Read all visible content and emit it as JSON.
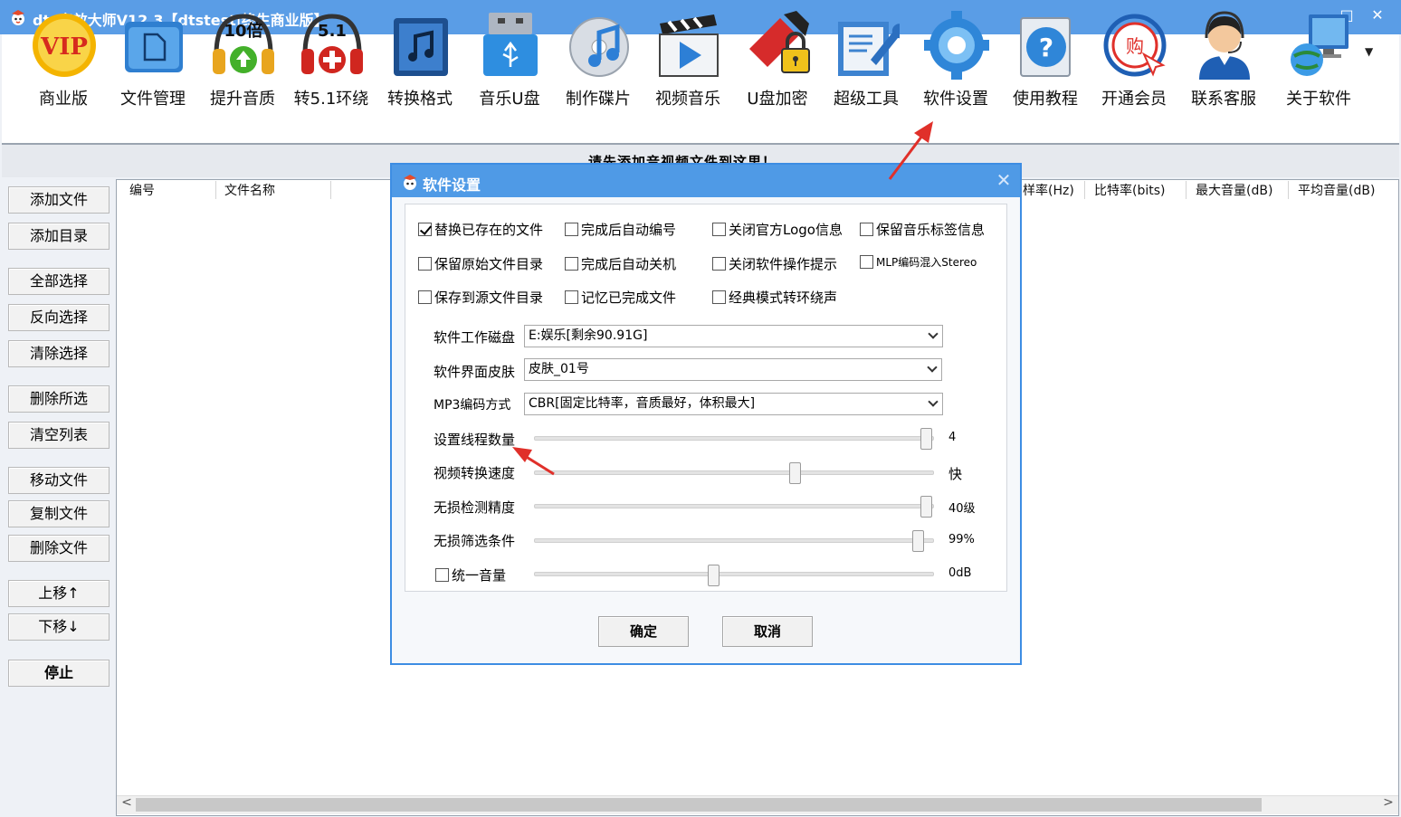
{
  "window": {
    "title": "dts音效大师V12.3【dtstest|终生商业版】",
    "minimize": "−",
    "maximize": "□",
    "close": "✕"
  },
  "toolbar": {
    "items": [
      {
        "label": "商业版",
        "icon": "vip-icon"
      },
      {
        "label": "文件管理",
        "icon": "file-manager-icon"
      },
      {
        "label": "提升音质",
        "icon": "boost-quality-icon",
        "badge": "10倍"
      },
      {
        "label": "转5.1环绕",
        "icon": "surround-icon",
        "badge": "5.1"
      },
      {
        "label": "转换格式",
        "icon": "convert-format-icon"
      },
      {
        "label": "音乐U盘",
        "icon": "usb-music-icon"
      },
      {
        "label": "制作碟片",
        "icon": "disc-icon"
      },
      {
        "label": "视频音乐",
        "icon": "video-music-icon"
      },
      {
        "label": "U盘加密",
        "icon": "usb-lock-icon"
      },
      {
        "label": "超级工具",
        "icon": "super-tools-icon"
      },
      {
        "label": "软件设置",
        "icon": "settings-gear-icon"
      },
      {
        "label": "使用教程",
        "icon": "help-icon"
      },
      {
        "label": "开通会员",
        "icon": "shop-member-icon",
        "badge": "购"
      },
      {
        "label": "联系客服",
        "icon": "customer-service-icon"
      },
      {
        "label": "关于软件",
        "icon": "about-icon"
      }
    ],
    "more": "▼"
  },
  "banner": "请先添加音视频文件到这里！",
  "sidebar": {
    "buttons": [
      "添加文件",
      "添加目录",
      "全部选择",
      "反向选择",
      "清除选择",
      "删除所选",
      "清空列表",
      "移动文件",
      "复制文件",
      "删除文件",
      "上移↑",
      "下移↓",
      "停止"
    ]
  },
  "filelist": {
    "columns": [
      "编号",
      "文件名称",
      "样率(Hz)",
      "比特率(bits)",
      "最大音量(dB)",
      "平均音量(dB)"
    ],
    "scroll_left": "<",
    "scroll_right": ">"
  },
  "dialog": {
    "title": "软件设置",
    "close": "✕",
    "checkboxes": [
      {
        "label": "替换已存在的文件",
        "checked": true
      },
      {
        "label": "完成后自动编号",
        "checked": false
      },
      {
        "label": "关闭官方Logo信息",
        "checked": false
      },
      {
        "label": "保留音乐标签信息",
        "checked": false
      },
      {
        "label": "保留原始文件目录",
        "checked": false
      },
      {
        "label": "完成后自动关机",
        "checked": false
      },
      {
        "label": "关闭软件操作提示",
        "checked": false
      },
      {
        "label": "MLP编码混入Stereo",
        "checked": false
      },
      {
        "label": "保存到源文件目录",
        "checked": false
      },
      {
        "label": "记忆已完成文件",
        "checked": false
      },
      {
        "label": "经典模式转环绕声",
        "checked": false
      }
    ],
    "selects": [
      {
        "label": "软件工作磁盘",
        "value": "E:娱乐[剩余90.91G]"
      },
      {
        "label": "软件界面皮肤",
        "value": "皮肤_01号"
      },
      {
        "label": "MP3编码方式",
        "value": "CBR[固定比特率，音质最好，体积最大]"
      }
    ],
    "sliders": [
      {
        "label": "设置线程数量",
        "value": "4",
        "level": 1.0
      },
      {
        "label": "视频转换速度",
        "value": "快",
        "level": 0.66
      },
      {
        "label": "无损检测精度",
        "value": "40级",
        "level": 1.0
      },
      {
        "label": "无损筛选条件",
        "value": "99%",
        "level": 0.98
      },
      {
        "label": "统一音量",
        "value": "0dB",
        "level": 0.45,
        "has_checkbox": true,
        "checked": false
      }
    ],
    "ok": "确定",
    "cancel": "取消"
  },
  "colors": {
    "titlebar": "#5a9de6",
    "dialog_title": "#4f9ae6",
    "annotation": "#e0302a"
  }
}
